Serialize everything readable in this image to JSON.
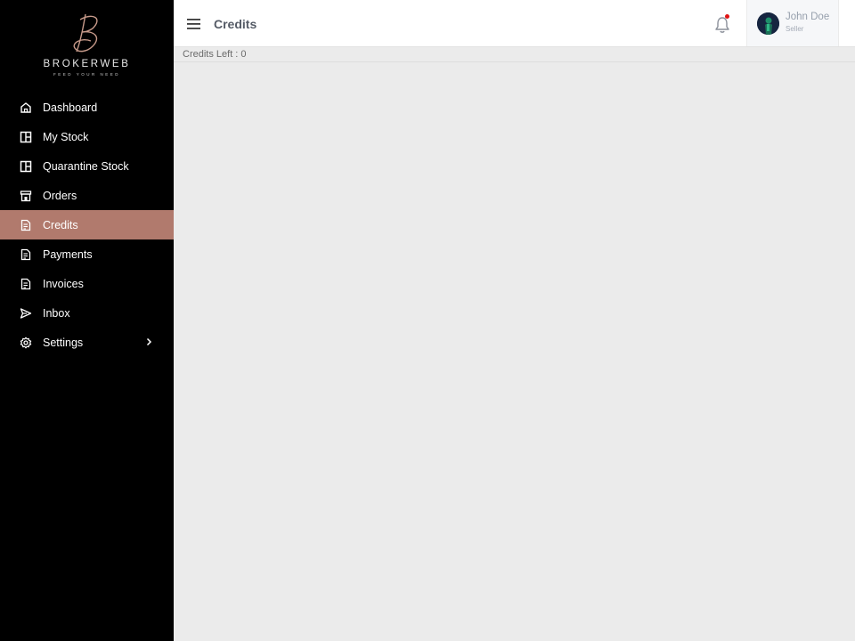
{
  "brand": {
    "name": "BROKERWEB",
    "tagline": "FEED YOUR NEED"
  },
  "sidebar": {
    "items": [
      {
        "label": "Dashboard",
        "icon": "home-icon"
      },
      {
        "label": "My Stock",
        "icon": "stock-icon"
      },
      {
        "label": "Quarantine Stock",
        "icon": "quarantine-icon"
      },
      {
        "label": "Orders",
        "icon": "store-icon"
      },
      {
        "label": "Credits",
        "icon": "document-icon",
        "active": true
      },
      {
        "label": "Payments",
        "icon": "document-icon"
      },
      {
        "label": "Invoices",
        "icon": "document-icon"
      },
      {
        "label": "Inbox",
        "icon": "send-icon"
      },
      {
        "label": "Settings",
        "icon": "gear-icon",
        "expandable": true
      }
    ]
  },
  "header": {
    "title": "Credits"
  },
  "user": {
    "name": "John Doe",
    "role": "Seller"
  },
  "main": {
    "credits_left": "Credits Left : 0"
  },
  "colors": {
    "sidebar_bg": "#000000",
    "active_bg": "#b17a6d",
    "notification_dot": "#e01414"
  }
}
